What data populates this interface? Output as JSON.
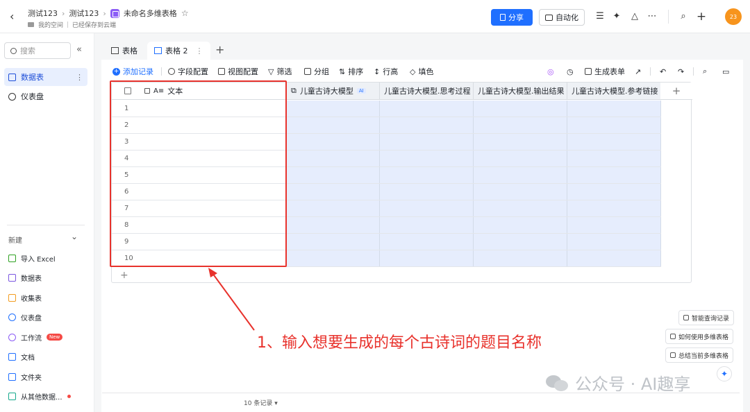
{
  "header": {
    "crumbs": [
      "测试123",
      "测试123"
    ],
    "doc_title": "未命名多维表格",
    "sub_space": "我的空间",
    "save_status": "已经保存到云端",
    "share_label": "分享",
    "automation_label": "自动化",
    "avatar_text": "23"
  },
  "sidebar": {
    "search_placeholder": "搜索",
    "items": [
      {
        "label": "数据表"
      },
      {
        "label": "仪表盘"
      }
    ],
    "new_label": "新建",
    "new_items": [
      {
        "label": "导入 Excel",
        "color": "#2ea121"
      },
      {
        "label": "数据表",
        "color": "#7a56e0"
      },
      {
        "label": "收集表",
        "color": "#f29c1f"
      },
      {
        "label": "仪表盘",
        "color": "#1f6fff"
      },
      {
        "label": "工作流",
        "color": "#8b5cf6"
      },
      {
        "label": "文档",
        "color": "#1f6fff"
      },
      {
        "label": "文件夹",
        "color": "#1f6fff"
      },
      {
        "label": "从其他数据...",
        "color": "#14a88b"
      }
    ],
    "workflow_badge": "New"
  },
  "tabs": [
    {
      "label": "表格"
    },
    {
      "label": "表格 2"
    }
  ],
  "toolbar": {
    "add_record": "添加记录",
    "field_config": "字段配置",
    "view_config": "视图配置",
    "filter": "筛选",
    "group": "分组",
    "sort": "排序",
    "row_height": "行高",
    "fill_color": "填色",
    "generate_form": "生成表单"
  },
  "grid": {
    "columns": [
      "文本",
      "儿童古诗大模型",
      "儿童古诗大模型.思考过程",
      "儿童古诗大模型.输出结果",
      "儿童古诗大模型.参考链接"
    ],
    "ai_tag": "AI",
    "rows": [
      "1",
      "2",
      "3",
      "4",
      "5",
      "6",
      "7",
      "8",
      "9",
      "10"
    ]
  },
  "annotation": "1、输入想要生成的每个古诗词的题目名称",
  "help": {
    "smart_query": "智能查询记录",
    "how_to_use": "如何使用多维表格",
    "summarize": "总结当前多维表格"
  },
  "watermark": "公众号 · AI趣享",
  "footer": {
    "records": "10 条记录"
  }
}
